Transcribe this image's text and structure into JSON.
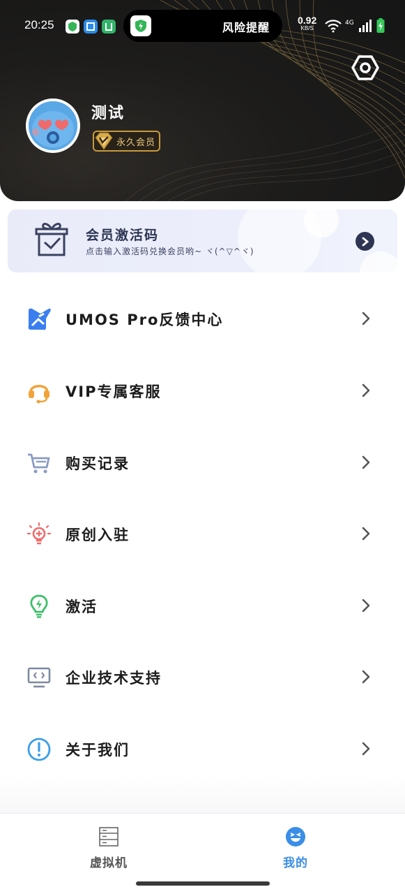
{
  "status_bar": {
    "time": "20:25",
    "alert_text": "风险提醒",
    "net_speed_value": "0.92",
    "net_speed_unit": "KB/S",
    "network": "4G",
    "wifi_icon": "wifi-icon",
    "signal_icon": "signal-icon",
    "battery_icon": "battery-charging-icon"
  },
  "profile": {
    "username": "测试",
    "membership_badge": "永久会员"
  },
  "activation_card": {
    "title": "会员激活码",
    "subtitle": "点击输入激活码兑换会员哟~ ヾ(^▽^ヾ)"
  },
  "menu": [
    {
      "label": "UMOS Pro反馈中心",
      "icon": "umos-logo-icon",
      "color": "#3a7ef0"
    },
    {
      "label": "VIP专属客服",
      "icon": "headset-icon",
      "color": "#f0a33a"
    },
    {
      "label": "购买记录",
      "icon": "cart-icon",
      "color": "#8a9bc4"
    },
    {
      "label": "原创入驻",
      "icon": "lightbulb-icon",
      "color": "#ef6b6b"
    },
    {
      "label": "激活",
      "icon": "bolt-bulb-icon",
      "color": "#3cbf6a"
    },
    {
      "label": "企业技术支持",
      "icon": "monitor-code-icon",
      "color": "#7f8aa0"
    },
    {
      "label": "关于我们",
      "icon": "info-icon",
      "color": "#3a9ee8"
    }
  ],
  "bottom_nav": {
    "tabs": [
      {
        "label": "虚拟机",
        "icon": "server-icon",
        "active": false
      },
      {
        "label": "我的",
        "icon": "smiley-icon",
        "active": true
      }
    ],
    "active_color": "#3a8ee6",
    "inactive_color": "#555555"
  }
}
